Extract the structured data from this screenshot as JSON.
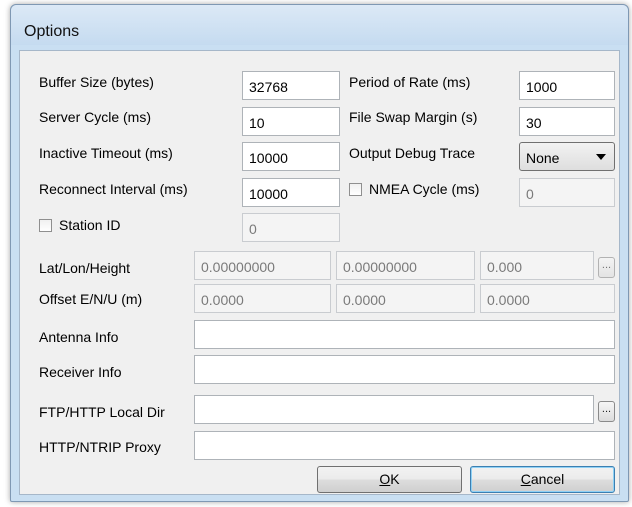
{
  "window": {
    "title": "Options"
  },
  "fields": {
    "buffer_size": {
      "label": "Buffer Size (bytes)",
      "value": "32768"
    },
    "period_of_rate": {
      "label": "Period of Rate (ms)",
      "value": "1000"
    },
    "server_cycle": {
      "label": "Server Cycle  (ms)",
      "value": "10"
    },
    "file_swap_margin": {
      "label": "File Swap Margin (s)",
      "value": "30"
    },
    "inactive_timeout": {
      "label": "Inactive Timeout (ms)",
      "value": "10000"
    },
    "output_debug_trace": {
      "label": "Output Debug Trace",
      "value": "None"
    },
    "reconnect_interval": {
      "label": "Reconnect Interval  (ms)",
      "value": "10000"
    },
    "nmea_cycle": {
      "label": "NMEA Cycle (ms)",
      "value": "0",
      "checked": false
    },
    "station_id": {
      "label": "Station ID",
      "value": "0",
      "checked": false
    },
    "lat_lon_height": {
      "label": "Lat/Lon/Height",
      "values": [
        "0.00000000",
        "0.00000000",
        "0.000"
      ]
    },
    "offset_enu": {
      "label": "Offset E/N/U (m)",
      "values": [
        "0.0000",
        "0.0000",
        "0.0000"
      ]
    },
    "antenna_info": {
      "label": "Antenna Info",
      "value": ""
    },
    "receiver_info": {
      "label": "Receiver Info",
      "value": ""
    },
    "ftp_http_local_dir": {
      "label": "FTP/HTTP Local Dir",
      "value": ""
    },
    "http_ntrip_proxy": {
      "label": "HTTP/NTRIP Proxy",
      "value": ""
    }
  },
  "buttons": {
    "browse": "...",
    "ok_mnemonic": "O",
    "ok_rest": "K",
    "cancel_mnemonic": "C",
    "cancel_rest": "ancel"
  },
  "colors": {
    "frame": "#c9dff2",
    "client": "#f0f0f0",
    "default_button_border": "#3c7fb1"
  }
}
